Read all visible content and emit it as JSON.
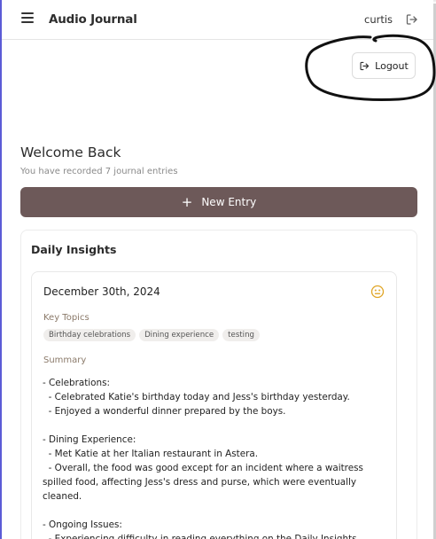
{
  "header": {
    "app_title": "Audio Journal",
    "username": "curtis"
  },
  "actions": {
    "logout_label": "Logout",
    "new_entry_label": "New Entry"
  },
  "welcome": {
    "title": "Welcome Back",
    "subtitle": "You have recorded 7 journal entries"
  },
  "insights": {
    "title": "Daily Insights",
    "entry": {
      "date": "December 30th, 2024",
      "mood_icon": "neutral-face-icon",
      "key_topics_label": "Key Topics",
      "topics": [
        "Birthday celebrations",
        "Dining experience",
        "testing"
      ],
      "summary_label": "Summary",
      "summary_text": "- Celebrations:\n  - Celebrated Katie's birthday today and Jess's birthday yesterday.\n  - Enjoyed a wonderful dinner prepared by the boys.\n\n- Dining Experience:\n  - Met Katie at her Italian restaurant in Astera.\n  - Overall, the food was good except for an incident where a waitress spilled food, affecting Jess's dress and purse, which were eventually cleaned.\n\n- Ongoing Issues:\n  - Experiencing difficulty in reading everything on the Daily Insights"
    }
  },
  "colors": {
    "primary_button": "#6d5959",
    "mood_accent": "#e0a526",
    "annotation_ink": "#111111"
  },
  "icons": {
    "menu": "hamburger-menu-icon",
    "logout": "logout-icon",
    "add": "plus-icon"
  }
}
